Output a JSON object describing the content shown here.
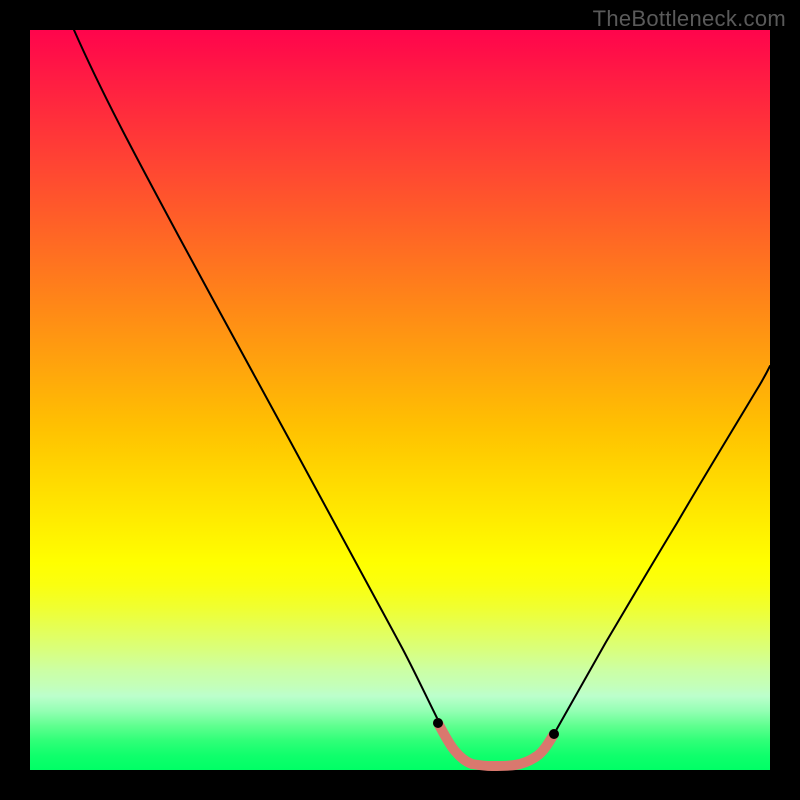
{
  "attribution": "TheBottleneck.com",
  "colors": {
    "curve": "#000000",
    "floor_band": "#d9786e",
    "background": "#000000"
  },
  "chart_data": {
    "type": "line",
    "title": "",
    "xlabel": "",
    "ylabel": "",
    "xlim": [
      0,
      100
    ],
    "ylim": [
      0,
      100
    ],
    "legend": false,
    "grid": false,
    "background_gradient": "vertical red→yellow→green (bottleneck severity scale)",
    "series": [
      {
        "name": "bottleneck-curve",
        "x": [
          6,
          10,
          15,
          20,
          25,
          30,
          35,
          40,
          45,
          50,
          54,
          56,
          58,
          60,
          62,
          64,
          66,
          68,
          70,
          75,
          80,
          85,
          90,
          95,
          100
        ],
        "y": [
          100,
          92,
          83,
          74,
          64,
          55,
          46,
          36,
          27,
          17,
          9,
          6,
          4,
          2.5,
          1.5,
          1,
          1,
          1.5,
          2.5,
          6,
          13,
          22,
          33,
          45,
          58
        ]
      }
    ],
    "optimal_range_x": [
      54,
      70
    ],
    "annotations": []
  }
}
